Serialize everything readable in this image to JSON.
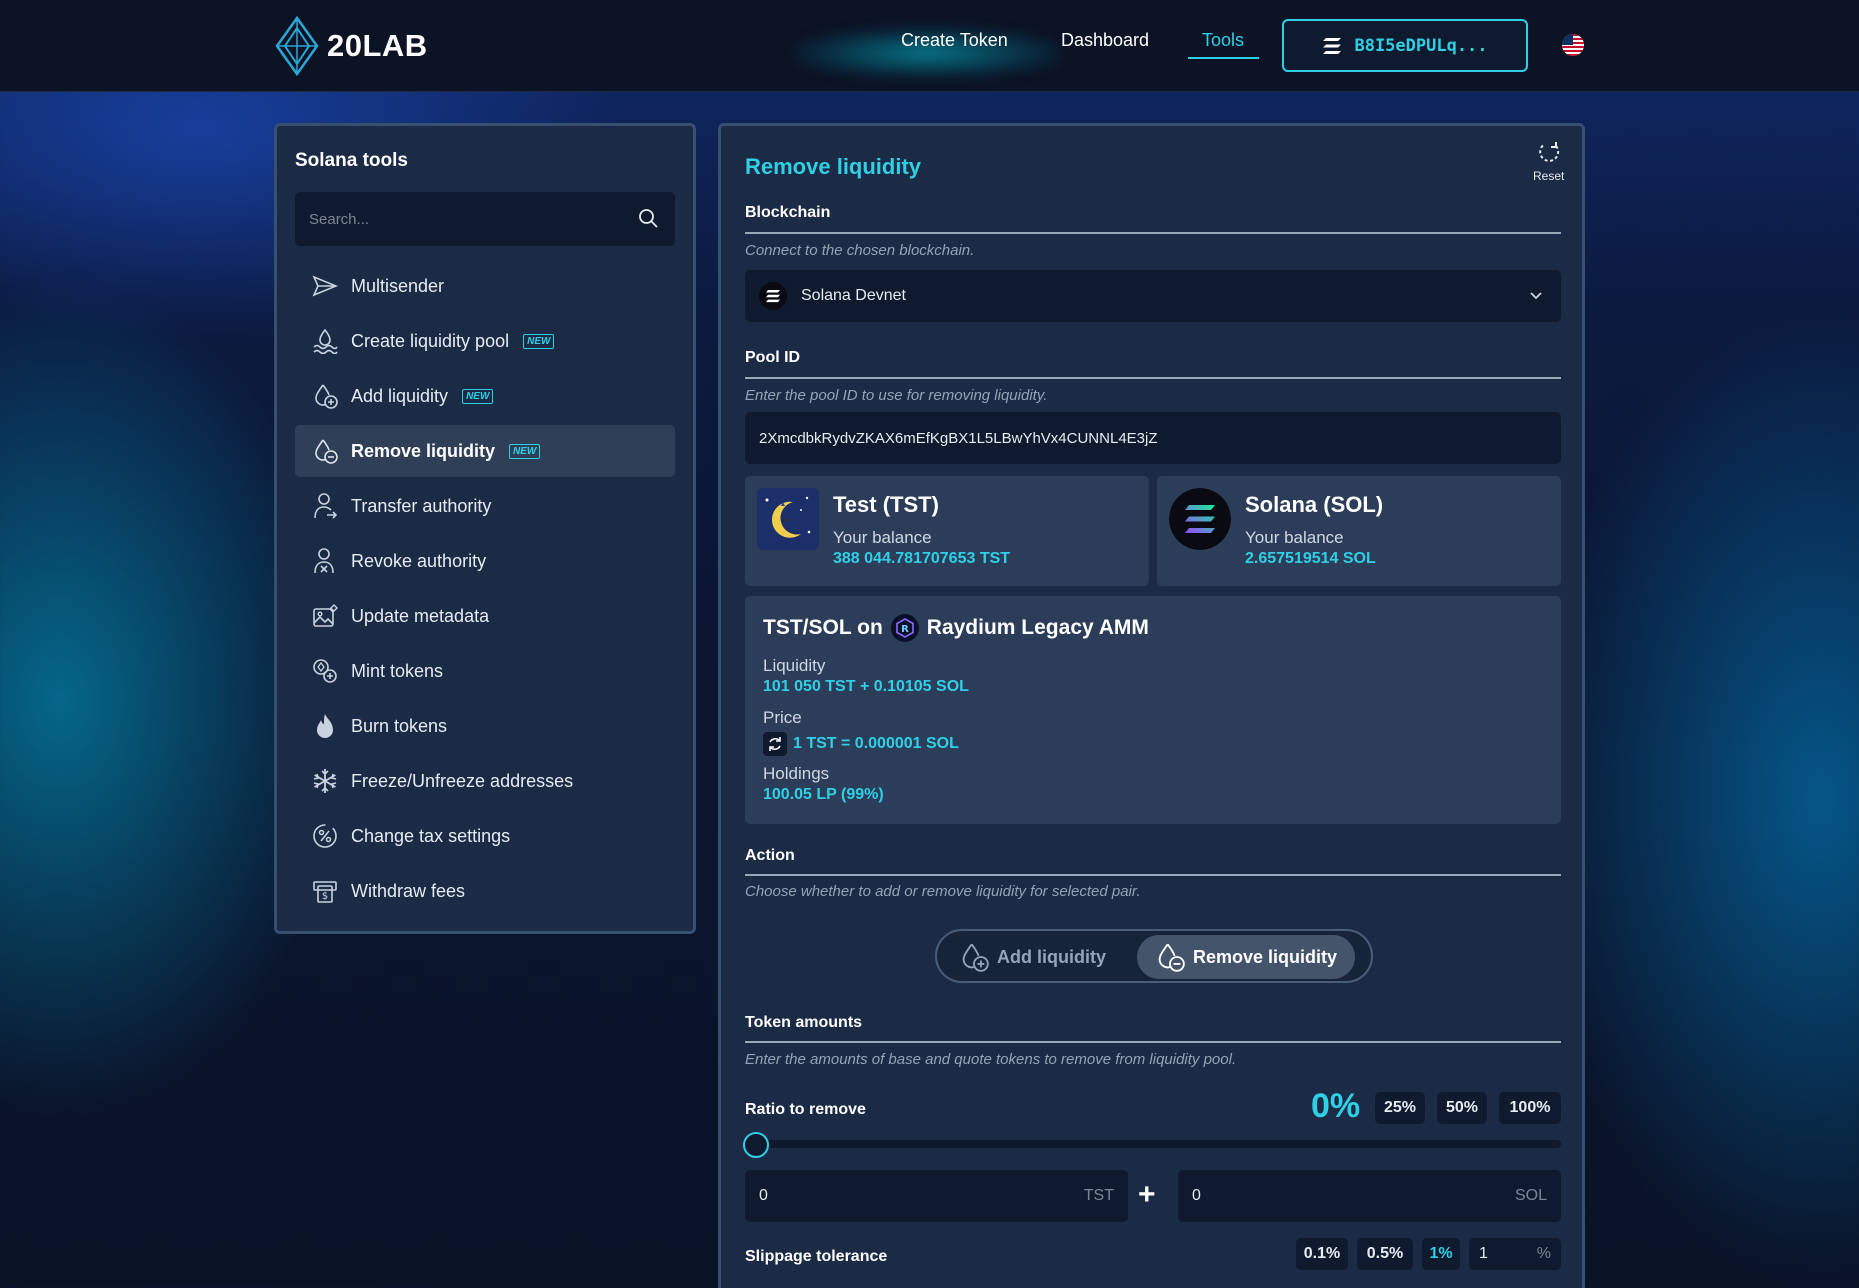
{
  "header": {
    "logo_text": "20LAB",
    "nav": [
      "Create Token",
      "Dashboard",
      "Tools"
    ],
    "active_nav": "Tools",
    "wallet": "B8I5eDPULq..."
  },
  "sidebar": {
    "title": "Solana tools",
    "search_placeholder": "Search...",
    "new_badge": "NEW",
    "items": [
      {
        "label": "Multisender",
        "icon": "send-icon",
        "new": false
      },
      {
        "label": "Create liquidity pool",
        "icon": "pool-icon",
        "new": true
      },
      {
        "label": "Add liquidity",
        "icon": "drop-plus-icon",
        "new": true
      },
      {
        "label": "Remove liquidity",
        "icon": "drop-minus-icon",
        "new": true,
        "active": true
      },
      {
        "label": "Transfer authority",
        "icon": "user-transfer-icon",
        "new": false
      },
      {
        "label": "Revoke authority",
        "icon": "user-revoke-icon",
        "new": false
      },
      {
        "label": "Update metadata",
        "icon": "image-edit-icon",
        "new": false
      },
      {
        "label": "Mint tokens",
        "icon": "mint-icon",
        "new": false
      },
      {
        "label": "Burn tokens",
        "icon": "flame-icon",
        "new": false
      },
      {
        "label": "Freeze/Unfreeze addresses",
        "icon": "snowflake-icon",
        "new": false
      },
      {
        "label": "Change tax settings",
        "icon": "percent-icon",
        "new": false
      },
      {
        "label": "Withdraw fees",
        "icon": "cash-icon",
        "new": false
      }
    ]
  },
  "main": {
    "title": "Remove liquidity",
    "reset_label": "Reset",
    "blockchain": {
      "label": "Blockchain",
      "description": "Connect to the chosen blockchain.",
      "value": "Solana Devnet"
    },
    "pool": {
      "label": "Pool ID",
      "description": "Enter the pool ID to use for removing liquidity.",
      "value": "2XmcdbkRydvZKAX6mEfKgBX1L5LBwYhVx4CUNNL4E3jZ"
    },
    "tokens": [
      {
        "name": "Test (TST)",
        "balance_label": "Your balance",
        "balance": "388 044.781707653 TST"
      },
      {
        "name": "Solana (SOL)",
        "balance_label": "Your balance",
        "balance": "2.657519514 SOL"
      }
    ],
    "pair": {
      "title_prefix": "TST/SOL on",
      "amm": "Raydium Legacy AMM",
      "liquidity_label": "Liquidity",
      "liquidity": "101 050 TST + 0.10105 SOL",
      "price_label": "Price",
      "price": "1 TST = 0.000001 SOL",
      "holdings_label": "Holdings",
      "holdings": "100.05 LP (99%)"
    },
    "action": {
      "label": "Action",
      "description": "Choose whether to add or remove liquidity for selected pair.",
      "add": "Add liquidity",
      "remove": "Remove liquidity"
    },
    "amounts": {
      "label": "Token amounts",
      "description": "Enter the amounts of base and quote tokens to remove from liquidity pool.",
      "ratio_label": "Ratio to remove",
      "ratio_value": "0%",
      "ratio_fraction": 0,
      "presets": [
        "25%",
        "50%",
        "100%"
      ],
      "base_value": "0",
      "base_unit": "TST",
      "quote_value": "0",
      "quote_unit": "SOL"
    },
    "slippage": {
      "label": "Slippage tolerance",
      "presets": [
        "0.1%",
        "0.5%",
        "1%"
      ],
      "active_preset": "1%",
      "value": "1",
      "unit": "%"
    }
  }
}
